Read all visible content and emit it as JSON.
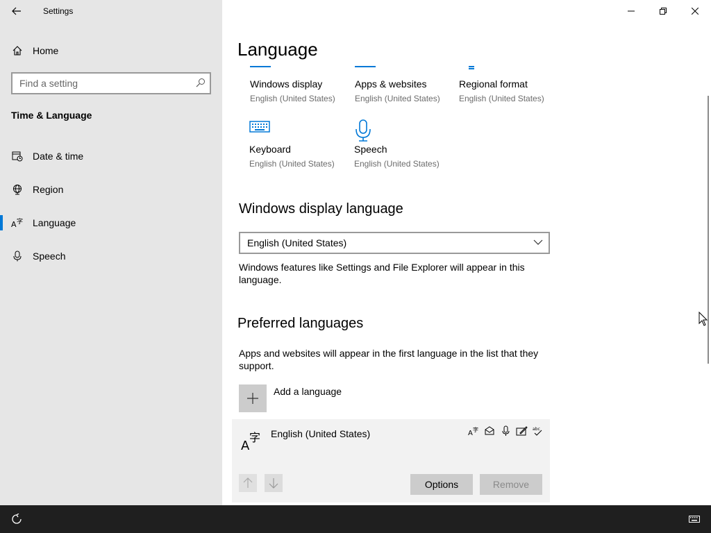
{
  "window": {
    "title": "Settings"
  },
  "sidebar": {
    "home_label": "Home",
    "search_placeholder": "Find a setting",
    "section_title": "Time & Language",
    "items": [
      {
        "label": "Date & time",
        "icon": "calendar-clock-icon"
      },
      {
        "label": "Region",
        "icon": "globe-icon"
      },
      {
        "label": "Language",
        "icon": "language-icon",
        "selected": true
      },
      {
        "label": "Speech",
        "icon": "microphone-icon"
      }
    ]
  },
  "main": {
    "page_title": "Language",
    "tiles": [
      {
        "title": "Windows display",
        "subtitle": "English (United States)"
      },
      {
        "title": "Apps & websites",
        "subtitle": "English (United States)"
      },
      {
        "title": "Regional format",
        "subtitle": "English (United States)"
      },
      {
        "title": "Keyboard",
        "subtitle": "English (United States)"
      },
      {
        "title": "Speech",
        "subtitle": "English (United States)"
      }
    ],
    "display_language": {
      "heading": "Windows display language",
      "selected": "English (United States)",
      "description": "Windows features like Settings and File Explorer will appear in this language."
    },
    "preferred": {
      "heading": "Preferred languages",
      "description": "Apps and websites will appear in the first language in the list that they support.",
      "add_label": "Add a language",
      "languages": [
        {
          "name": "English (United States)",
          "options_label": "Options",
          "remove_label": "Remove"
        }
      ]
    }
  },
  "colors": {
    "accent": "#0078d7",
    "sidebar_bg": "#e6e6e6",
    "taskbar_bg": "#1f1f1f"
  }
}
